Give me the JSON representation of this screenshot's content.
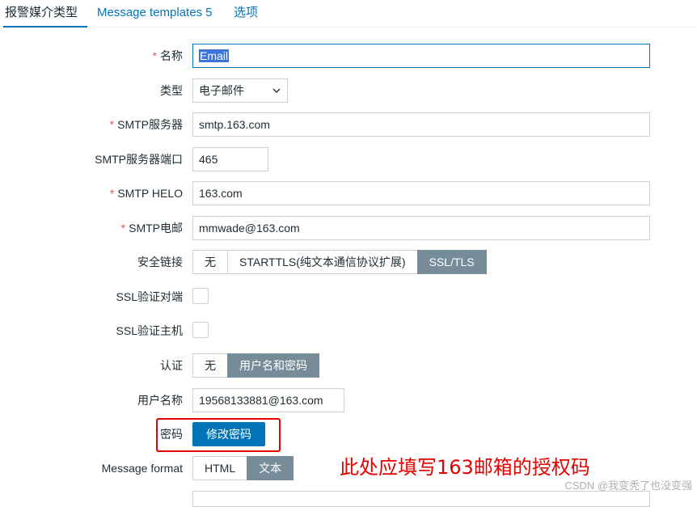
{
  "tabs": [
    {
      "label": "报警媒介类型",
      "active": true
    },
    {
      "label": "Message templates",
      "count": "5"
    },
    {
      "label": "选项"
    }
  ],
  "form": {
    "name": {
      "label": "名称",
      "required": "*",
      "value": "Email"
    },
    "type": {
      "label": "类型",
      "value": "电子邮件"
    },
    "smtp_server": {
      "label": "SMTP服务器",
      "required": "*",
      "value": "smtp.163.com"
    },
    "smtp_port": {
      "label": "SMTP服务器端口",
      "value": "465"
    },
    "smtp_helo": {
      "label": "SMTP HELO",
      "required": "*",
      "value": "163.com"
    },
    "smtp_email": {
      "label": "SMTP电邮",
      "required": "*",
      "value": "mmwade@163.com"
    },
    "security": {
      "label": "安全链接",
      "options": [
        "无",
        "STARTTLS(纯文本通信协议扩展)",
        "SSL/TLS"
      ],
      "selected": "SSL/TLS"
    },
    "ssl_verify_peer": {
      "label": "SSL验证对端",
      "checked": false
    },
    "ssl_verify_host": {
      "label": "SSL验证主机",
      "checked": false
    },
    "auth": {
      "label": "认证",
      "options": [
        "无",
        "用户名和密码"
      ],
      "selected": "用户名和密码"
    },
    "username": {
      "label": "用户名称",
      "value": "19568133881@163.com"
    },
    "password": {
      "label": "密码",
      "button": "修改密码"
    },
    "message_format": {
      "label": "Message format",
      "options": [
        "HTML",
        "文本"
      ],
      "selected": "文本"
    }
  },
  "annotation": "此处应填写163邮箱的授权码",
  "watermark": "CSDN @我变秃了也没变强",
  "colors": {
    "accent": "#0275b8",
    "segment_active": "#768d99",
    "annotation": "#e60000",
    "required": "#e45959"
  }
}
